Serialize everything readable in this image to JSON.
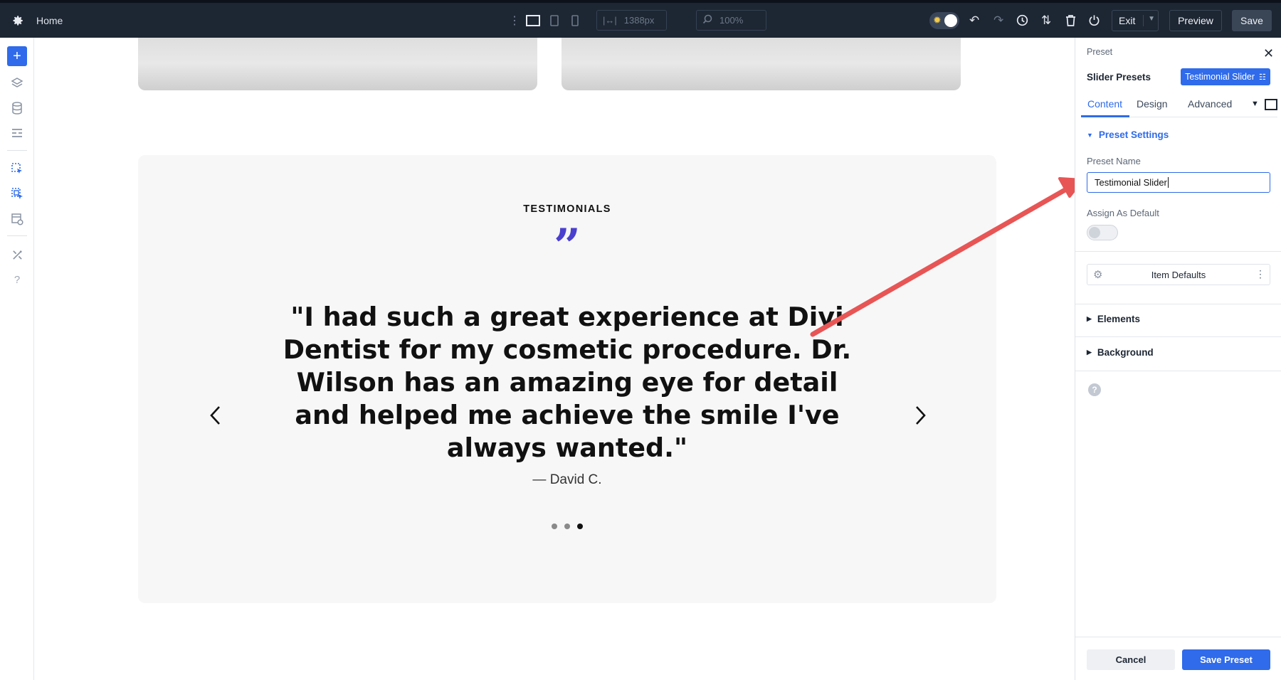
{
  "topbar": {
    "page_title": "Home",
    "width_value": "1388px",
    "zoom_value": "100%",
    "exit_label": "Exit",
    "preview_label": "Preview",
    "save_label": "Save"
  },
  "canvas": {
    "section_heading": "TESTIMONIALS",
    "quote_mark": "”",
    "quote_text": "\"I had such a great experience at Divi Dentist for my cosmetic procedure. Dr. Wilson has an amazing eye for detail and helped me achieve the smile I've always wanted.\"",
    "author": "— David C.",
    "prev_arrow": "‹",
    "next_arrow": "›",
    "slides_total": 3,
    "active_slide": 3
  },
  "panel": {
    "breadcrumb": "Preset",
    "title": "Slider Presets",
    "preset_chip": "Testimonial Slider",
    "tabs": [
      {
        "label": "Content",
        "active": true
      },
      {
        "label": "Design",
        "active": false
      },
      {
        "label": "Advanced",
        "active": false
      }
    ],
    "preset_settings_label": "Preset Settings",
    "preset_name_label": "Preset Name",
    "preset_name_value": "Testimonial Slider",
    "assign_default_label": "Assign As Default",
    "assign_default_on": false,
    "item_defaults_label": "Item Defaults",
    "elements_label": "Elements",
    "background_label": "Background",
    "cancel_label": "Cancel",
    "save_preset_label": "Save Preset"
  },
  "colors": {
    "topbar_bg": "#1d2633",
    "accent_blue": "#2f6bea",
    "quote_purple": "#4b3fcf",
    "annotation_red": "#e85555"
  },
  "icons": {
    "topbar": [
      "gear-icon",
      "drag-handle-icon",
      "desktop-view-icon",
      "tablet-view-icon",
      "phone-view-icon",
      "width-icon",
      "zoom-icon",
      "theme-toggle-icon",
      "undo-icon",
      "redo-icon",
      "history-icon",
      "sort-icon",
      "trash-icon",
      "power-icon",
      "chevron-down-icon"
    ],
    "leftbar": [
      "add-icon",
      "layers-icon",
      "database-icon",
      "layout-icon",
      "select-element-icon",
      "select-multiple-icon",
      "template-settings-icon",
      "tools-icon",
      "help-icon"
    ]
  }
}
